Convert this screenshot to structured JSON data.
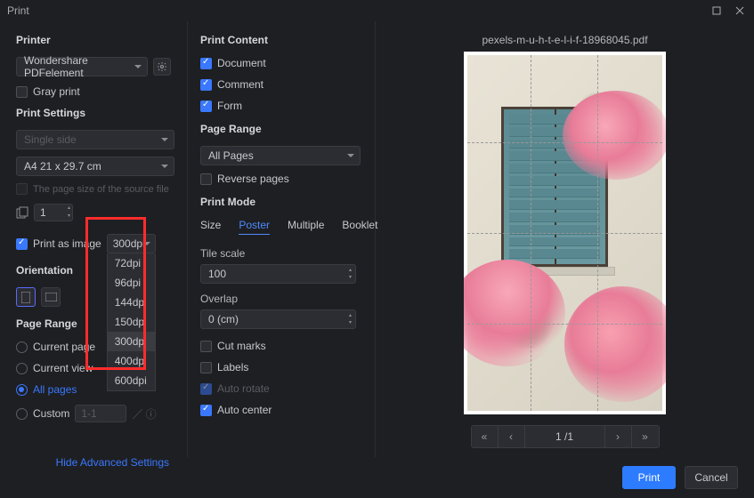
{
  "window": {
    "title": "Print"
  },
  "col1": {
    "printer_label": "Printer",
    "printer_value": "Wondershare PDFelement",
    "gray_print": "Gray print",
    "settings_label": "Print Settings",
    "sides_value": "Single side",
    "paper_value": "A4 21 x 29.7 cm",
    "source_size": "The page size of the source file",
    "copies_value": "1",
    "print_as_image": "Print as image",
    "dpi_selected": "300dpi",
    "dpi_options": [
      "72dpi",
      "96dpi",
      "144dpi",
      "150dpi",
      "300dpi",
      "400dpi",
      "600dpi"
    ],
    "orientation_label": "Orientation",
    "range_label": "Page Range",
    "range": {
      "current_page": "Current page",
      "current_view": "Current view",
      "all_pages": "All pages",
      "custom": "Custom",
      "custom_value": "1-1"
    },
    "advanced": "Hide Advanced Settings"
  },
  "col2": {
    "content_label": "Print Content",
    "content": {
      "document": "Document",
      "comment": "Comment",
      "form": "Form"
    },
    "range_label": "Page Range",
    "range_value": "All Pages",
    "reverse": "Reverse pages",
    "mode_label": "Print Mode",
    "tabs": {
      "size": "Size",
      "poster": "Poster",
      "multiple": "Multiple",
      "booklet": "Booklet"
    },
    "tile_label": "Tile scale",
    "tile_value": "100",
    "overlap_label": "Overlap",
    "overlap_value": "0 (cm)",
    "cut_marks": "Cut marks",
    "labels": "Labels",
    "auto_rotate": "Auto rotate",
    "auto_center": "Auto center"
  },
  "preview": {
    "filename": "pexels-m-u-h-t-e-l-i-f-18968045.pdf",
    "page_indicator": "1 /1"
  },
  "footer": {
    "print": "Print",
    "cancel": "Cancel"
  }
}
